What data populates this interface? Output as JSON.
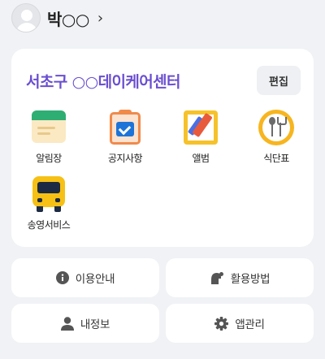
{
  "profile": {
    "name": "박○○",
    "chevron": "›",
    "avatar_icon": "user-avatar-icon"
  },
  "center": {
    "name": "서초구 ○○데이케어센터",
    "edit_label": "편집"
  },
  "menu": [
    {
      "label": "알림장",
      "icon": "notice-book-icon"
    },
    {
      "label": "공지사항",
      "icon": "announcement-icon"
    },
    {
      "label": "앨범",
      "icon": "album-icon"
    },
    {
      "label": "식단표",
      "icon": "meal-menu-icon"
    },
    {
      "label": "송영서비스",
      "icon": "shuttle-bus-icon"
    }
  ],
  "tiles": [
    {
      "label": "이용안내",
      "icon": "info-icon"
    },
    {
      "label": "활용방법",
      "icon": "usage-icon"
    },
    {
      "label": "내정보",
      "icon": "person-icon"
    },
    {
      "label": "앱관리",
      "icon": "gear-icon"
    }
  ],
  "colors": {
    "center_name": "#6a4fd0",
    "background": "#f0f2f5"
  }
}
